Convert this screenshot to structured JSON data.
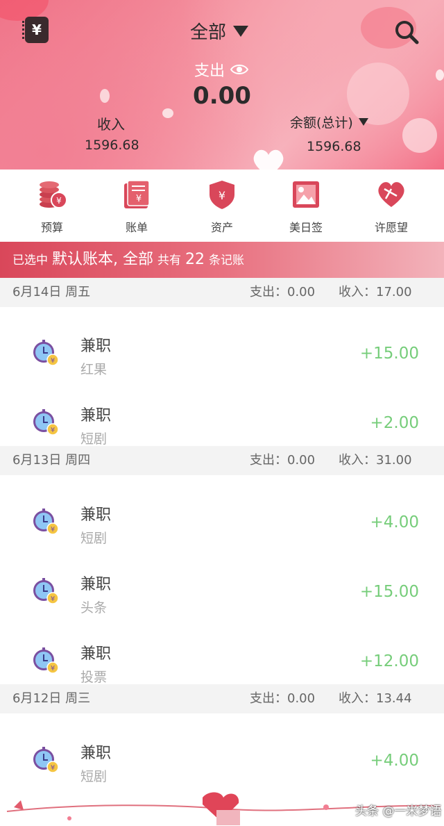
{
  "header": {
    "book_selector": "全部",
    "expense_label": "支出",
    "expense_value": "0.00",
    "income_label": "收入",
    "income_value": "1596.68",
    "balance_label": "余额(总计)",
    "balance_value": "1596.68",
    "wallet_glyph": "¥"
  },
  "quicknav": [
    {
      "label": "预算",
      "icon": "budget-coins-icon"
    },
    {
      "label": "账单",
      "icon": "bill-icon"
    },
    {
      "label": "资产",
      "icon": "asset-shield-icon"
    },
    {
      "label": "美日签",
      "icon": "picture-icon"
    },
    {
      "label": "许愿望",
      "icon": "wish-heart-icon"
    }
  ],
  "banner": {
    "prefix": "已选中",
    "book": "默认账本, 全部",
    "mid": "共有",
    "count": "22",
    "suffix": "条记账"
  },
  "days": [
    {
      "date": "6月14日 周五",
      "expense": "支出：0.00",
      "income": "收入：17.00",
      "entries": [
        {
          "category": "兼职",
          "note": "红果",
          "amount": "+15.00"
        },
        {
          "category": "兼职",
          "note": "短剧",
          "amount": "+2.00"
        }
      ]
    },
    {
      "date": "6月13日 周四",
      "expense": "支出：0.00",
      "income": "收入：31.00",
      "entries": [
        {
          "category": "兼职",
          "note": "短剧",
          "amount": "+4.00"
        },
        {
          "category": "兼职",
          "note": "头条",
          "amount": "+15.00"
        },
        {
          "category": "兼职",
          "note": "投票",
          "amount": "+12.00"
        }
      ]
    },
    {
      "date": "6月12日 周三",
      "expense": "支出：0.00",
      "income": "收入：13.44",
      "entries": [
        {
          "category": "兼职",
          "note": "短剧",
          "amount": "+4.00"
        }
      ]
    }
  ],
  "watermark": "头条 @一米梦语",
  "colors": {
    "accent": "#d9475a",
    "income_green": "#76cd7a"
  }
}
